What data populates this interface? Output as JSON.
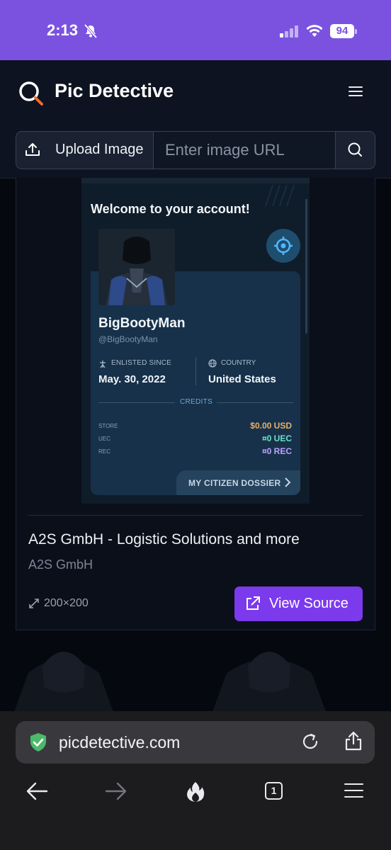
{
  "status_bar": {
    "time": "2:13",
    "battery": "94"
  },
  "app": {
    "title": "Pic Detective"
  },
  "search": {
    "upload_label": "Upload Image",
    "url_placeholder": "Enter image URL"
  },
  "result": {
    "preview": {
      "welcome": "Welcome to your account!",
      "username": "BigBootyMan",
      "handle": "@BigBootyMan",
      "enlisted_label": "ENLISTED SINCE",
      "enlisted_date": "May. 30, 2022",
      "country_label": "COUNTRY",
      "country": "United States",
      "credits_label": "CREDITS",
      "credits": [
        {
          "key": "STORE",
          "value": "$0.00 USD"
        },
        {
          "key": "UEC",
          "value": "¤0 UEC"
        },
        {
          "key": "REC",
          "value": "¤0 REC"
        }
      ],
      "dossier_label": "MY CITIZEN DOSSIER"
    },
    "title": "A2S GmbH - Logistic Solutions and more",
    "site": "A2S GmbH",
    "dimensions": "200×200",
    "view_source_label": "View Source"
  },
  "browser": {
    "url": "picdetective.com",
    "tab_count": "1"
  },
  "colors": {
    "status_bar": "#7b52e0",
    "accent": "#7c3aed",
    "app_bg": "#05080f",
    "browser_bar": "#1c1c1e"
  }
}
